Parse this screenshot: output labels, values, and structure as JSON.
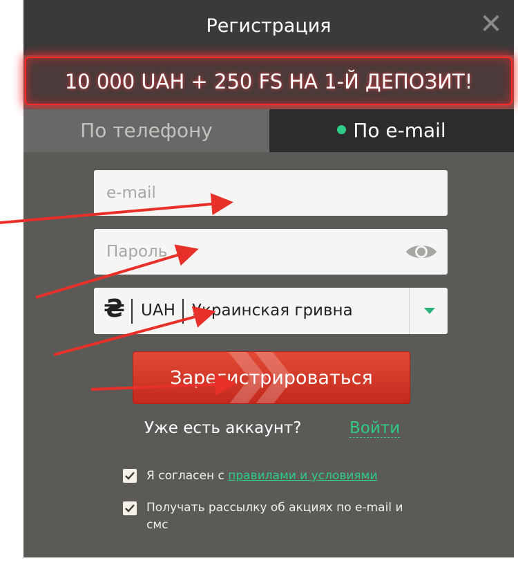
{
  "modal": {
    "title": "Регистрация",
    "close_icon": "close-icon",
    "promo": "10 000 UAH + 250 FS НА 1-Й ДЕПОЗИТ!"
  },
  "tabs": {
    "phone": "По телефону",
    "email": "По e-mail",
    "active": "email"
  },
  "form": {
    "email_placeholder": "e-mail",
    "password_placeholder": "Пароль",
    "currency": {
      "symbol": "₴",
      "code": "UAH",
      "name": "Украинская гривна"
    },
    "register_label": "Зарегистрироваться"
  },
  "account": {
    "question": "Уже есть аккаунт?",
    "login_label": "Войти"
  },
  "consents": {
    "agree_prefix": "Я согласен с ",
    "agree_link": "правилами и условиями",
    "agree_checked": true,
    "newsletter": "Получать рассылку об акциях по e-mail и смс",
    "newsletter_checked": true
  },
  "colors": {
    "accent_green": "#2ecc87",
    "promo_glow": "#ff2a2a",
    "button_red": "#d63a2a",
    "annotation_arrow": "#e8302a"
  }
}
